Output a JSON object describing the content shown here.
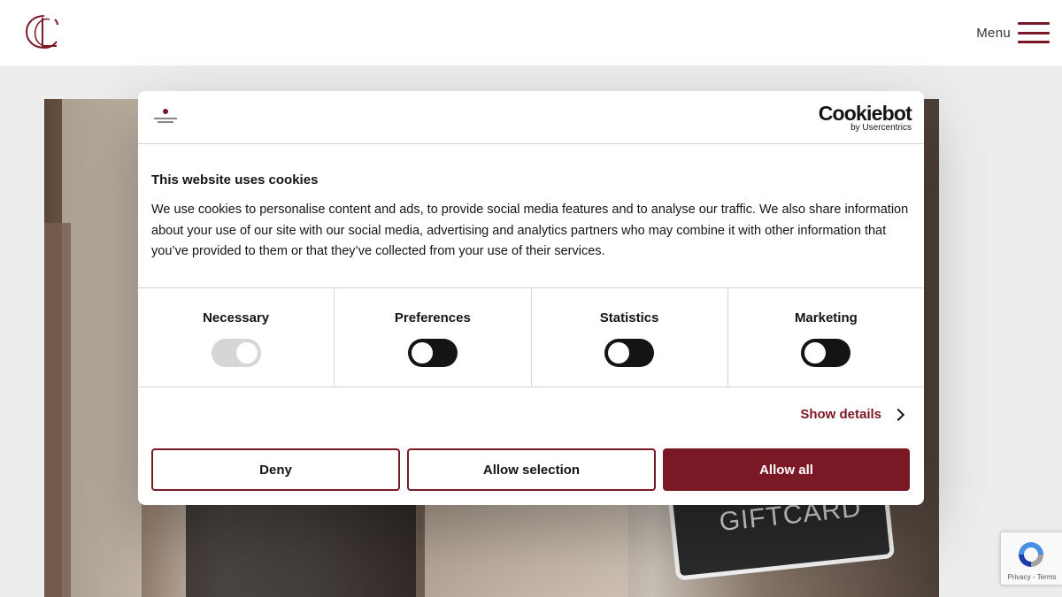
{
  "header": {
    "menu_label": "Menu"
  },
  "cookie_dialog": {
    "brand_logo_icon": "churchill-living-logo",
    "provider_name": "Cookiebot",
    "provider_sub": "by Usercentrics",
    "title": "This website uses cookies",
    "description": "We use cookies to personalise content and ads, to provide social media features and to analyse our traffic. We also share information about your use of our site with our social media, advertising and analytics partners who may combine it with other information that you’ve provided to them or that they’ve collected from your use of their services.",
    "categories": [
      {
        "label": "Necessary",
        "enabled": true,
        "locked": true
      },
      {
        "label": "Preferences",
        "enabled": false,
        "locked": false
      },
      {
        "label": "Statistics",
        "enabled": false,
        "locked": false
      },
      {
        "label": "Marketing",
        "enabled": false,
        "locked": false
      }
    ],
    "show_details_label": "Show details",
    "buttons": {
      "deny": "Deny",
      "allow_selection": "Allow selection",
      "allow_all": "Allow all"
    }
  },
  "hero": {
    "giftcard_text": "GIFTCARD"
  },
  "recaptcha": {
    "terms": "Privacy - Terms"
  },
  "colors": {
    "brand": "#7a1825",
    "toggle_off": "#141414",
    "toggle_disabled": "#d6d6d6",
    "background": "#ededed"
  },
  "icons": [
    "cl-monogram-logo",
    "hamburger-icon",
    "chevron-right-icon",
    "recaptcha-icon"
  ]
}
